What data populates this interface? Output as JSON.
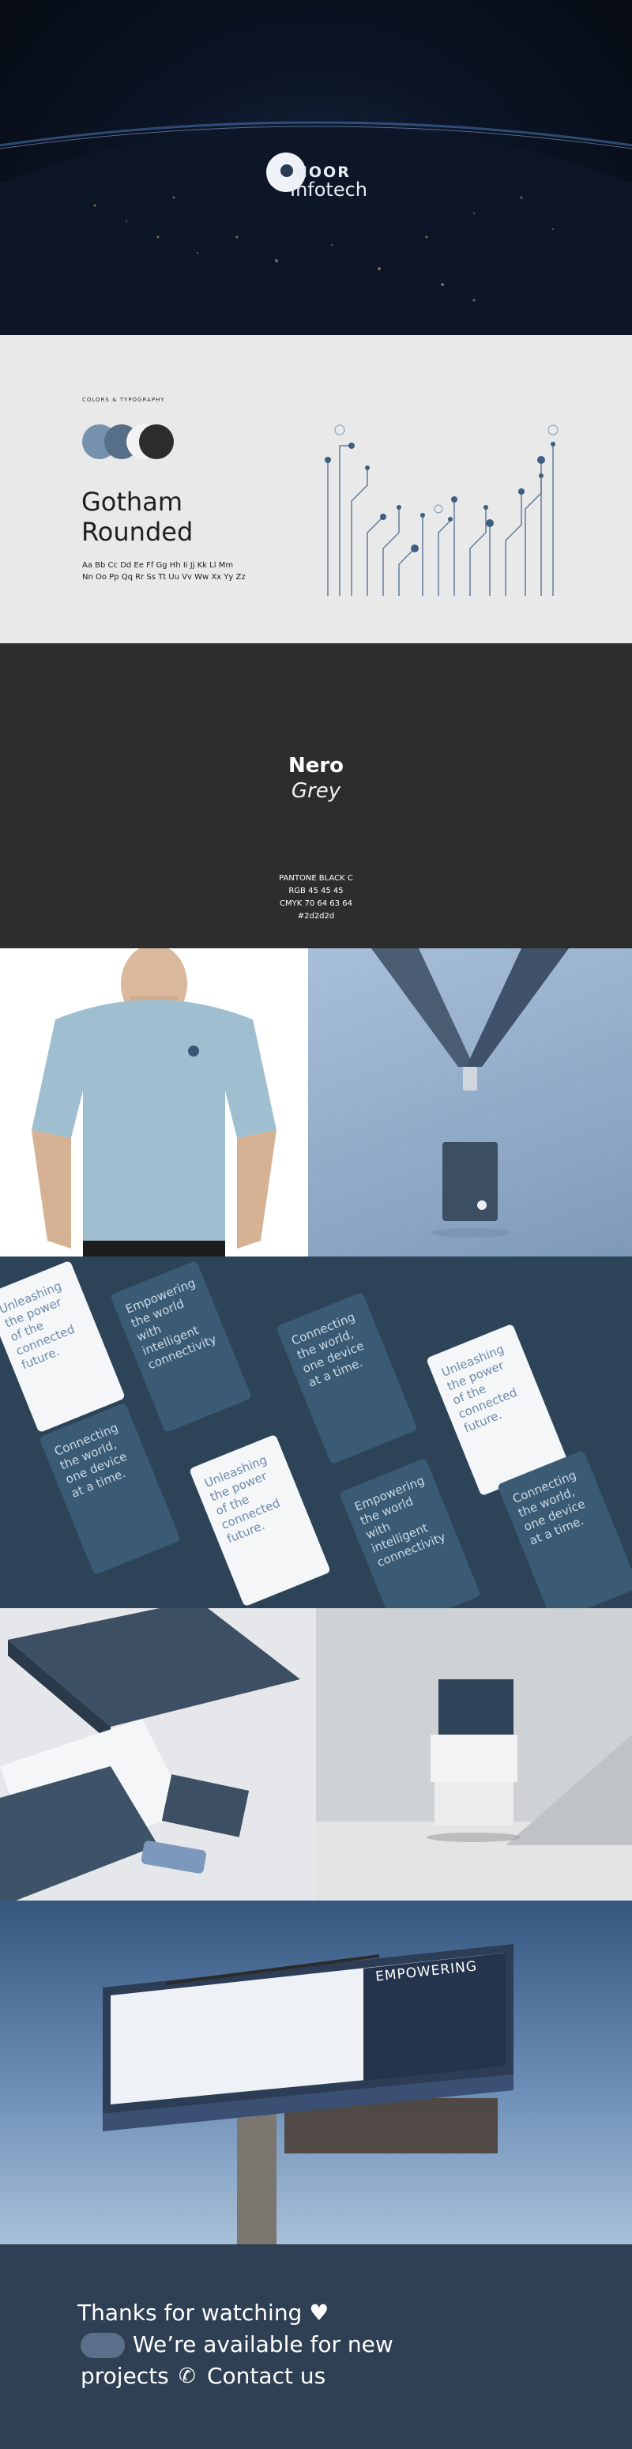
{
  "hero": {
    "brand_top": "NOOR",
    "brand_bottom": "Infotech"
  },
  "colors_typography": {
    "caption": "COLORS & TYPOGRAPHY",
    "swatches": [
      "#7691ae",
      "#566e86",
      "#f2f2f2",
      "#2d2d2d"
    ],
    "font_line1": "Gotham",
    "font_line2": "Rounded",
    "alphabet_line1": "Aa Bb Cc Dd Ee Ff Gg Hh Ii Jj Kk Ll Mm",
    "alphabet_line2": "Nn Oo Pp Qq Rr Ss Tt Uu Vv Ww Xx Yy Zz"
  },
  "color_spec": {
    "name_line1": "Nero",
    "name_line2": "Grey",
    "pantone": "PANTONE BLACK C",
    "rgb": "RGB 45 45 45",
    "cmyk": "CMYK 70 64 63 64",
    "hex": "#2d2d2d"
  },
  "cards": {
    "connecting": "Connecting the world, one device at a time.",
    "empowering": "Empowering the world with intelligent connectivity",
    "unleashing": "Unleashing the power of the connected future."
  },
  "billboard": {
    "headline": "EMPOWERING"
  },
  "footer": {
    "line1": "Thanks for watching",
    "line2": "We’re available for new",
    "line3": "projects",
    "line4": "Contact us"
  }
}
